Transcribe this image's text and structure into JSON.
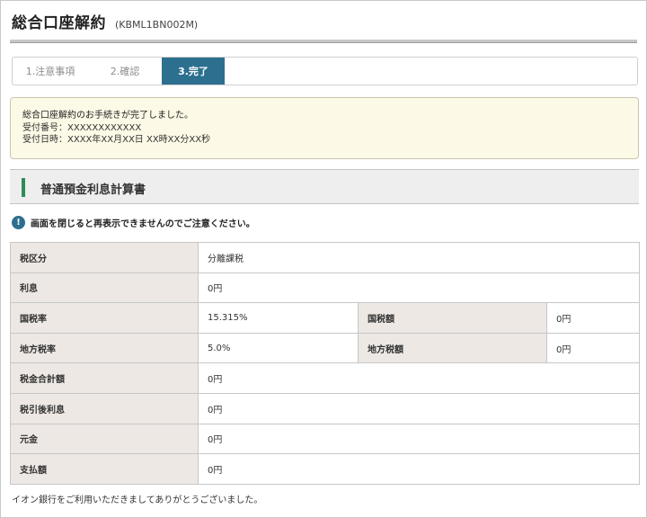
{
  "header": {
    "title": "総合口座解約",
    "code": "(KBML1BN002M)"
  },
  "steps": [
    {
      "label": "1.注意事項",
      "state": "done"
    },
    {
      "label": "2.確認",
      "state": "done"
    },
    {
      "label": "3.完了",
      "state": "current"
    }
  ],
  "notice": {
    "message": "総合口座解約のお手続きが完了しました。",
    "receipt_number": "受付番号：XXXXXXXXXXXX",
    "receipt_datetime": "受付日時：XXXX年XX月XX日 XX時XX分XX秒"
  },
  "section": {
    "title": "普通預金利息計算書"
  },
  "warning": {
    "icon": "exclamation-icon",
    "text": "画面を閉じると再表示できませんのでご注意ください。"
  },
  "table": {
    "tax_category": {
      "label": "税区分",
      "value": "分離課税"
    },
    "interest": {
      "label": "利息",
      "value": "0円"
    },
    "national_tax_rate": {
      "label": "国税率",
      "value": "15.315%"
    },
    "national_tax_amount": {
      "label": "国税額",
      "value": "0円"
    },
    "local_tax_rate": {
      "label": "地方税率",
      "value": "5.0%"
    },
    "local_tax_amount": {
      "label": "地方税額",
      "value": "0円"
    },
    "total_tax": {
      "label": "税金合計額",
      "value": "0円"
    },
    "after_tax_interest": {
      "label": "税引後利息",
      "value": "0円"
    },
    "principal": {
      "label": "元金",
      "value": "0円"
    },
    "payment": {
      "label": "支払額",
      "value": "0円"
    }
  },
  "footer": {
    "text": "イオン銀行をご利用いただきましてありがとうございました。"
  },
  "colors": {
    "accent": "#2d6f8f",
    "section_bar": "#2e8b57",
    "notice_bg": "#fcf9e6",
    "table_header_bg": "#ede8e4"
  }
}
